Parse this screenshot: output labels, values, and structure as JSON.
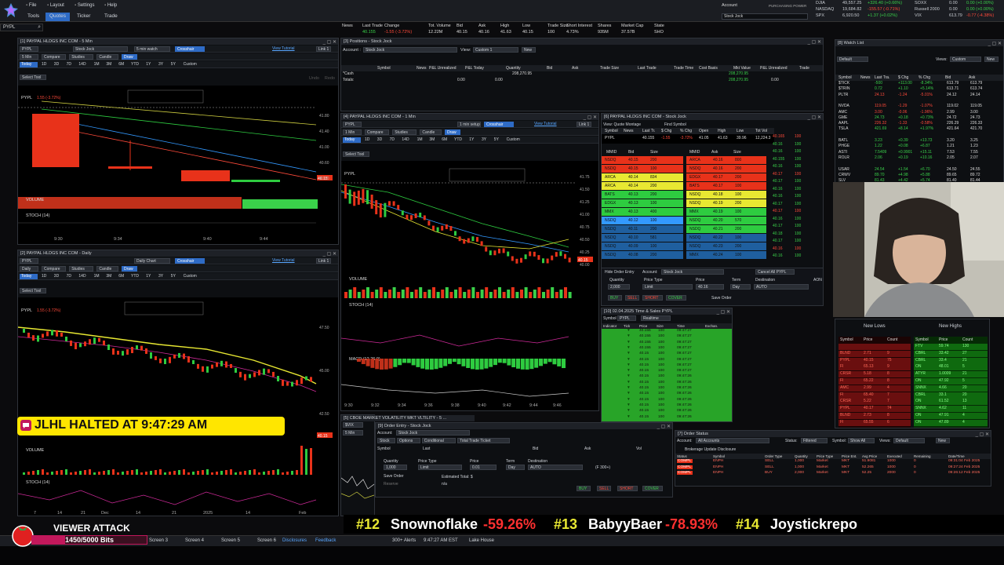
{
  "menubar": {
    "items": [
      "File",
      "Layout",
      "Settings",
      "Help"
    ],
    "tabs": [
      "Tools",
      "Quotes",
      "Ticker",
      "Trade"
    ],
    "symbol_input": "PYPL",
    "account_label": "Account",
    "account_value": "Stock Jock",
    "purchasing_power_label": "PURCHASING POWER"
  },
  "indices": [
    {
      "sym": "DJIA",
      "val": "49,557.25",
      "chg": "+326.40 (+0.66%)",
      "sym2": "SOXX",
      "v2": "0.00",
      "c2": "0.00 (+0.00%)"
    },
    {
      "sym": "NASDAQ",
      "val": "19,684.82",
      "chg": "-155.57 (-0.71%)",
      "sym2": "Russell 2000",
      "v2": "0.00",
      "c2": "0.00 (+0.00%)"
    },
    {
      "sym": "SPX",
      "val": "6,920.50",
      "chg": "+1.37 (+0.02%)",
      "sym2": "VIX",
      "v2": "613.79",
      "c2": "-0.77 (-4.38%)"
    }
  ],
  "colors": {
    "accent": "#2e6bc6",
    "up": "#3ad14a",
    "down": "#ff4a3a",
    "halt_banner": "#ffe600",
    "viewer_bar": "#c2185b"
  },
  "news_header": {
    "cols": [
      "News",
      "Last Trade",
      "Change",
      "Tot. Volume",
      "Bid",
      "Ask",
      "High",
      "Low",
      "Trade Size",
      "Short Interest",
      "Shares",
      "Market Cap",
      "State"
    ],
    "vals": [
      "",
      "40.155",
      "-1.55 (-3.72%)",
      "12.22M",
      "40.15",
      "40.16",
      "41.63",
      "40.15",
      "100",
      "4.73%",
      "935M",
      "37.57B",
      "SHO"
    ]
  },
  "chart1": {
    "title": "[1] PAYPAL HLDGS INC COM - 5 Min",
    "symbol": "PYPL",
    "price_tag": "40.15",
    "sublabel": "1.55 (-3.72%)",
    "volume_label": "VOLUME",
    "stoch_label": "STOCH (14)",
    "x_ticks": [
      "9:30",
      "9:34",
      "9:40",
      "9:44"
    ],
    "y_ticks": [
      "41.80",
      "41.40",
      "41.00",
      "40.60",
      "40.20"
    ],
    "account": "Stock Jock",
    "interval": "5 min watch",
    "crosshair": "Crosshair",
    "tutorial": "View Tutorial",
    "link": "Link 1",
    "chips": [
      "5 Min",
      "Compare",
      "Studies",
      "Candle",
      "Draw"
    ],
    "ranges": [
      "Today",
      "1D",
      "3D",
      "7D",
      "14D",
      "1M",
      "3M",
      "6M",
      "YTD",
      "1Y",
      "3Y",
      "5Y",
      "Custom"
    ],
    "select_tool": "Select Tool",
    "undo": "Undo",
    "redo": "Redo"
  },
  "chart2": {
    "title": "[2] PAYPAL HLDGS INC COM - Daily",
    "symbol": "PYPL",
    "price_tag": "40.15",
    "sublabel": "1.55 (-3.72%)",
    "volume_label": "VOLUME",
    "stoch_label": "STOCH (14)",
    "x_ticks": [
      "7",
      "14",
      "21",
      "Dec",
      "14",
      "21",
      "2025",
      "14",
      "Feb"
    ],
    "y_ticks": [
      "47.50",
      "45.00",
      "42.50"
    ],
    "interval": "Daily Chart",
    "chips": [
      "Daily",
      "Compare",
      "Studies",
      "Candle",
      "Draw"
    ]
  },
  "positions": {
    "title": "[3] Positions - Stock Jock",
    "account_label": "Account :",
    "account_value": "Stock Jock",
    "view_label": "View:",
    "view_value": "Custom 1",
    "new_btn": "New",
    "cols": [
      "Symbol",
      "News",
      "P&L Unrealized",
      "P&L Today",
      "Quantity",
      "Bid",
      "Ask",
      "Trade Size",
      "Last Trade",
      "Trade Time",
      "Cost Basis",
      "Mkt Value",
      "P&L Unrealized",
      "Trade"
    ],
    "rows": [
      {
        "name": "*Cash",
        "qty": "208,270.95",
        "mkt": "208,270.95",
        "pnl": ""
      },
      {
        "name": "Totals:",
        "qty": "",
        "mkt": "208,270.95",
        "pnl": "0.00",
        "pnl_u": "0.00",
        "pnl_t": "0.00"
      }
    ]
  },
  "chart4": {
    "title": "[4] PAYPAL HLDGS INC COM - 1 Min",
    "symbol": "PYPL",
    "price_tag": "40.15",
    "volume_label": "VOLUME",
    "stoch_label": "STOCH (14)",
    "macd_label": "MACD (12,26,9)",
    "x_ticks": [
      "9:30",
      "9:32",
      "9:34",
      "9:36",
      "9:38",
      "9:40",
      "9:42",
      "9:44",
      "9:46"
    ],
    "y_ticks": [
      "41.75",
      "41.50",
      "41.25",
      "41.00",
      "40.75",
      "40.50",
      "40.25",
      "40.00"
    ],
    "interval": "1 min setup",
    "chips": [
      "1 Min",
      "Compare",
      "Studies",
      "Candle",
      "Draw"
    ]
  },
  "montage": {
    "title": "[6] PAYPAL HLDGS INC COM - Stock Jock",
    "view_label": "View: Quote Montage",
    "find_symbol": "Find Symbol",
    "symbol": "PYPL",
    "quote_cols": [
      "Symbol",
      "News",
      "Last Tr.",
      "$ Chg",
      "% Chg",
      "Open",
      "High",
      "Low",
      "Tot Vol"
    ],
    "quote_vals": [
      "PYPL",
      "",
      "40.155",
      "-1.55",
      "-3.72%",
      "41.05",
      "41.63",
      "39.96",
      "12,224.3"
    ],
    "bid_cols": [
      "MMID",
      "Bid",
      "Size"
    ],
    "ask_cols": [
      "MMID",
      "Ask",
      "Size"
    ],
    "bids": [
      {
        "mm": "NSDQ",
        "px": "40.15",
        "sz": "200"
      },
      {
        "mm": "NSDQ",
        "px": "40.15",
        "sz": "100"
      },
      {
        "mm": "ARCA",
        "px": "40.14",
        "sz": "834"
      },
      {
        "mm": "ARCA",
        "px": "40.14",
        "sz": "200"
      },
      {
        "mm": "BATS",
        "px": "40.13",
        "sz": "200"
      },
      {
        "mm": "EDGX",
        "px": "40.13",
        "sz": "100"
      },
      {
        "mm": "MMX",
        "px": "40.13",
        "sz": "400"
      },
      {
        "mm": "NSDQ",
        "px": "40.12",
        "sz": "100"
      },
      {
        "mm": "NSDQ",
        "px": "40.11",
        "sz": "200"
      },
      {
        "mm": "NSDQ",
        "px": "40.10",
        "sz": "581"
      },
      {
        "mm": "NSDQ",
        "px": "40.09",
        "sz": "100"
      },
      {
        "mm": "NSDQ",
        "px": "40.08",
        "sz": "200"
      }
    ],
    "asks": [
      {
        "mm": "ARCA",
        "px": "40.16",
        "sz": "800"
      },
      {
        "mm": "NSDQ",
        "px": "40.16",
        "sz": "200"
      },
      {
        "mm": "EDGX",
        "px": "40.17",
        "sz": "200"
      },
      {
        "mm": "BATS",
        "px": "40.17",
        "sz": "100"
      },
      {
        "mm": "NSDQ",
        "px": "40.18",
        "sz": "100"
      },
      {
        "mm": "NSDQ",
        "px": "40.19",
        "sz": "200"
      },
      {
        "mm": "MMX",
        "px": "40.19",
        "sz": "100"
      },
      {
        "mm": "NSDQ",
        "px": "40.20",
        "sz": "570"
      },
      {
        "mm": "NSDQ",
        "px": "40.21",
        "sz": "200"
      },
      {
        "mm": "NSDQ",
        "px": "40.22",
        "sz": "100"
      },
      {
        "mm": "NSDQ",
        "px": "40.23",
        "sz": "200"
      },
      {
        "mm": "MMX",
        "px": "40.24",
        "sz": "100"
      }
    ],
    "tape": [
      "40.165",
      "40.16",
      "40.16",
      "40.155",
      "40.16",
      "40.17",
      "40.17",
      "40.16",
      "40.16",
      "40.17",
      "40.17",
      "40.16",
      "40.17",
      "40.18",
      "40.17",
      "40.16",
      "40.16"
    ],
    "tape_sizes": [
      "100",
      "100",
      "100",
      "100",
      "100",
      "100",
      "100",
      "100",
      "100",
      "100",
      "100",
      "100",
      "100",
      "100",
      "100",
      "100",
      "100"
    ],
    "order_entry_label": "Hide Order Entry",
    "account_label": "Account:",
    "account_value": "Stock Jock",
    "cancel_all": "Cancel All PYPL",
    "quantity_label": "Quantity",
    "quantity_value": "2,000",
    "price_type_label": "Price Type",
    "price_type_value": "Limit",
    "price_label": "Price",
    "price_value": "40.16",
    "term_label": "Term",
    "term_value": "Day",
    "dest_label": "Destination",
    "dest_value": "AUTO",
    "aon": "AON",
    "buy": "BUY",
    "sell": "SELL",
    "short": "SHORT",
    "cover": "COVER",
    "save_order": "Save Order"
  },
  "tns": {
    "title": "[10] 02.04.2025 Time & Sales PYPL",
    "symbol_label": "Symbol",
    "symbol": "PYPL",
    "mode": "Realtime",
    "cols": [
      "Indicator",
      "Tick",
      "Price",
      "Size",
      "Time",
      "Exchan."
    ],
    "rows": [
      {
        "px": "40.155",
        "sz": "100",
        "t": "09:47:27"
      },
      {
        "px": "40.155",
        "sz": "100",
        "t": "09:47:27"
      },
      {
        "px": "40.155",
        "sz": "100",
        "t": "09:47:27"
      },
      {
        "px": "40.155",
        "sz": "100",
        "t": "09:47:27"
      },
      {
        "px": "40.15",
        "sz": "100",
        "t": "09:47:27"
      },
      {
        "px": "40.15",
        "sz": "100",
        "t": "09:47:27"
      },
      {
        "px": "40.15",
        "sz": "100",
        "t": "09:47:27"
      },
      {
        "px": "40.15",
        "sz": "100",
        "t": "09:47:27"
      },
      {
        "px": "40.15",
        "sz": "100",
        "t": "09:47:26"
      },
      {
        "px": "40.15",
        "sz": "100",
        "t": "09:47:26"
      },
      {
        "px": "40.15",
        "sz": "100",
        "t": "09:47:26"
      },
      {
        "px": "40.15",
        "sz": "100",
        "t": "09:47:26"
      },
      {
        "px": "40.15",
        "sz": "100",
        "t": "09:47:26"
      },
      {
        "px": "40.15",
        "sz": "100",
        "t": "09:47:26"
      },
      {
        "px": "40.15",
        "sz": "100",
        "t": "09:47:26"
      },
      {
        "px": "40.15",
        "sz": "100",
        "t": "09:47:26"
      }
    ]
  },
  "watchlist": {
    "title": "[8] Watch List",
    "views_label": "Views:",
    "views_value": "Custom",
    "new_btn": "New",
    "list_value": "Default",
    "cols": [
      "Symbol",
      "News",
      "Last Tra.",
      "$ Chg",
      "% Chg",
      "Bid",
      "Ask"
    ],
    "rows": [
      {
        "s": "$TICK",
        "l": "-500",
        "c": "+113.00",
        "p": "-8.34%",
        "b": "613.79",
        "a": "613.79",
        "up": true
      },
      {
        "s": "$TRIN",
        "l": "0.72",
        "c": "+1.10",
        "p": "+5.14%",
        "b": "613.71",
        "a": "613.74",
        "up": true
      },
      {
        "s": "PLTR",
        "l": "24.13",
        "c": "-1.24",
        "p": "-5.01%",
        "b": "24.12",
        "a": "24.14",
        "up": false
      },
      {
        "s": "",
        "l": "",
        "c": "",
        "p": "",
        "b": "",
        "a": "",
        "up": true
      },
      {
        "s": "NVDA",
        "l": "119.05",
        "c": "-1.29",
        "p": "-1.07%",
        "b": "119.02",
        "a": "119.05",
        "up": false
      },
      {
        "s": "AMC",
        "l": "3.00",
        "c": "-0.06",
        "p": "-1.96%",
        "b": "2.99",
        "a": "3.00",
        "up": false
      },
      {
        "s": "GME",
        "l": "24.73",
        "c": "+0.18",
        "p": "+0.73%",
        "b": "24.72",
        "a": "24.73",
        "up": true
      },
      {
        "s": "AAPL",
        "l": "226.32",
        "c": "-1.33",
        "p": "-0.58%",
        "b": "226.29",
        "a": "226.33",
        "up": false
      },
      {
        "s": "TSLA",
        "l": "421.69",
        "c": "+8.14",
        "p": "+1.97%",
        "b": "421.64",
        "a": "421.70",
        "up": true
      },
      {
        "s": "",
        "l": "",
        "c": "",
        "p": "",
        "b": "",
        "a": "",
        "up": true
      },
      {
        "s": "BATL",
        "l": "3.23",
        "c": "+0.39",
        "p": "+13.73",
        "b": "3.20",
        "a": "3.25",
        "up": true
      },
      {
        "s": "PHGE",
        "l": "1.22",
        "c": "+0.08",
        "p": "+6.87",
        "b": "1.21",
        "a": "1.23",
        "up": true
      },
      {
        "s": "ASTI",
        "l": "7.5409",
        "c": "+0.9901",
        "p": "+15.11",
        "b": "7.53",
        "a": "7.55",
        "up": true
      },
      {
        "s": "ROLR",
        "l": "2.06",
        "c": "+0.19",
        "p": "+10.16",
        "b": "2.05",
        "a": "2.07",
        "up": true
      },
      {
        "s": "",
        "l": "",
        "c": "",
        "p": "",
        "b": "",
        "a": "",
        "up": true
      },
      {
        "s": "USAR",
        "l": "24.54",
        "c": "+1.54",
        "p": "+6.70",
        "b": "24.50",
        "a": "24.55",
        "up": true
      },
      {
        "s": "CRWV",
        "l": "89.70",
        "c": "+4.98",
        "p": "+5.88",
        "b": "89.65",
        "a": "89.72",
        "up": true
      },
      {
        "s": "SLV",
        "l": "81.43",
        "c": "+4.42",
        "p": "+5.74",
        "b": "81.40",
        "a": "81.44",
        "up": true
      }
    ]
  },
  "lows_highs": {
    "lows_title": "New Lows",
    "highs_title": "New Highs",
    "cols": [
      "Symbol",
      "Price",
      "Count"
    ],
    "lows": [
      {
        "s": "",
        "p": "",
        "c": ""
      },
      {
        "s": "BLND",
        "p": "2.71",
        "c": "9"
      },
      {
        "s": "PYPL",
        "p": "40.15",
        "c": "75"
      },
      {
        "s": "FI",
        "p": "65.13",
        "c": "9"
      },
      {
        "s": "CRSR",
        "p": "5.18",
        "c": "8"
      },
      {
        "s": "FI",
        "p": "65.22",
        "c": "8"
      },
      {
        "s": "AMC",
        "p": "2.99",
        "c": "4"
      },
      {
        "s": "FI",
        "p": "65.40",
        "c": "7"
      },
      {
        "s": "CRSR",
        "p": "5.22",
        "c": "7"
      },
      {
        "s": "PYPL",
        "p": "40.17",
        "c": "74"
      },
      {
        "s": "BLND",
        "p": "2.73",
        "c": "8"
      },
      {
        "s": "FI",
        "p": "65.55",
        "c": "6"
      }
    ],
    "highs": [
      {
        "s": "FTV",
        "p": "59.74",
        "c": "130"
      },
      {
        "s": "CBRL",
        "p": "33.42",
        "c": "27"
      },
      {
        "s": "CBRL",
        "p": "33.4",
        "c": "21"
      },
      {
        "s": "ON",
        "p": "48.01",
        "c": "5"
      },
      {
        "s": "ATYR",
        "p": "1.0009",
        "c": "21"
      },
      {
        "s": "ON",
        "p": "47.92",
        "c": "5"
      },
      {
        "s": "SNNX",
        "p": "4.66",
        "c": "20"
      },
      {
        "s": "CBRL",
        "p": "33.1",
        "c": "20"
      },
      {
        "s": "ON",
        "p": "61.52",
        "c": "13"
      },
      {
        "s": "SNNX",
        "p": "4.62",
        "c": "11"
      },
      {
        "s": "ON",
        "p": "47.91",
        "c": "4"
      },
      {
        "s": "ON",
        "p": "47.89",
        "c": "4"
      }
    ]
  },
  "vix": {
    "title": "[5] CBOE MARKET VOLATILITY MKT VLTILITY - 5 ...",
    "symbol": "$VIX",
    "interval": "5 Min"
  },
  "order_entry": {
    "title": "[9] Order Entry - Stock Jock",
    "account_label": "Account:",
    "account_value": "Stock Jock",
    "tabs": [
      "Stock",
      "Options",
      "Conditional",
      "Total Trade Ticket"
    ],
    "symbol_label": "Symbol",
    "last_label": "Last",
    "bid_label": "Bid",
    "ask_label": "Ask",
    "vol_label": "Vol",
    "qty_label": "Quantity",
    "qty_value": "1,000",
    "price_type_label": "Price Type",
    "price_type_value": "Limit",
    "price_label": "Price",
    "price_value": "0.01",
    "term_label": "Term",
    "term_value": "Day",
    "dest_label": "Destination",
    "dest_value": "AUTO",
    "lots": "(F 300+)",
    "save_order": "Save Order",
    "reserve": "Reserve",
    "est_total_label": "Estimated Total: $",
    "est_total_value": "n/a",
    "buy": "BUY",
    "sell": "SELL",
    "short": "SHORT",
    "cover": "COVER"
  },
  "order_status": {
    "title": "[7] Order Status",
    "account_label": "Account:",
    "account_value": "All Accounts",
    "status_label": "Status:",
    "status_value": "Filtered",
    "symbol_label": "Symbol:",
    "symbol_value": "Show All",
    "views_label": "Views:",
    "views_value": "Default",
    "new_btn": "New",
    "disclosure": "Brokerage Update Disclosure",
    "cols": [
      "Status",
      "Symbol",
      "Order Type",
      "Quantity",
      "Price Type",
      "Price Ent.",
      "Avg Price",
      "Executed",
      "Remaining",
      "Date/Time"
    ],
    "rows": [
      {
        "st": "COMPL",
        "sym": "ENPH",
        "type": "SELL",
        "qty": "1,000",
        "pt": "Market",
        "pe": "MKT",
        "avg": "51.9081",
        "ex": "1000",
        "rem": "0",
        "dt": "09:31:04 Feb 2025"
      },
      {
        "st": "COMPL",
        "sym": "ENPH",
        "type": "SELL",
        "qty": "1,000",
        "pt": "Market",
        "pe": "MKT",
        "avg": "52.265",
        "ex": "1000",
        "rem": "0",
        "dt": "09:27:24 Feb 2025"
      },
      {
        "st": "COMPL",
        "sym": "ENPH",
        "type": "BUY",
        "qty": "2,000",
        "pt": "Market",
        "pe": "MKT",
        "avg": "52.25",
        "ex": "2000",
        "rem": "0",
        "dt": "09:26:12 Feb 2025"
      }
    ]
  },
  "halt_banner": {
    "text": "JLHL HALTED AT 9:47:29 AM"
  },
  "viewer_attack": {
    "title": "VIEWER ATTACK",
    "progress_text": "1450/5000 Bits",
    "progress_fraction": 0.29
  },
  "ticker_tape": [
    {
      "rank": "#12",
      "name": "Snownoflake",
      "pct": "-59.26%"
    },
    {
      "rank": "#13",
      "name": "BabyyBaer",
      "pct": "-78.93%"
    },
    {
      "rank": "#14",
      "name": "Joystickrepo",
      "pct": ""
    }
  ],
  "taskbar": {
    "items": [
      "Screen 3",
      "Screen 4",
      "Screen 5",
      "Screen 6",
      "Disclosures",
      "Feedback"
    ],
    "alerts": "300+ Alerts",
    "clock": "9:47:27 AM EST",
    "location": "Lake House"
  }
}
